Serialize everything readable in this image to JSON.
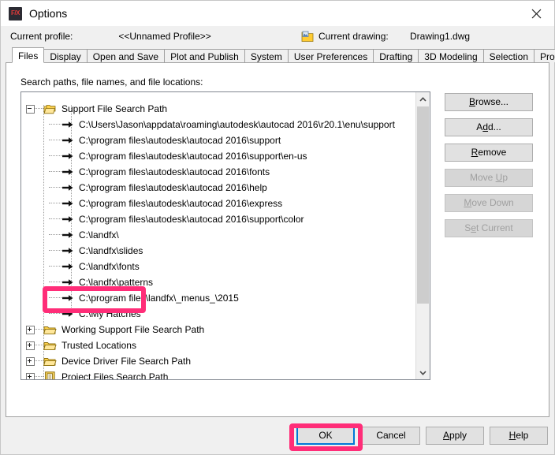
{
  "window": {
    "title": "Options",
    "app_icon": "fx-logo-icon",
    "close_icon": "close-icon"
  },
  "profile_bar": {
    "profile_label": "Current profile:",
    "profile_value": "<<Unnamed Profile>>",
    "drawing_icon": "drawing-file-icon",
    "drawing_label": "Current drawing:",
    "drawing_value": "Drawing1.dwg"
  },
  "tabs": [
    {
      "label": "Files",
      "active": true
    },
    {
      "label": "Display",
      "active": false
    },
    {
      "label": "Open and Save",
      "active": false
    },
    {
      "label": "Plot and Publish",
      "active": false
    },
    {
      "label": "System",
      "active": false
    },
    {
      "label": "User Preferences",
      "active": false
    },
    {
      "label": "Drafting",
      "active": false
    },
    {
      "label": "3D Modeling",
      "active": false
    },
    {
      "label": "Selection",
      "active": false
    },
    {
      "label": "Profiles",
      "active": false
    }
  ],
  "files_panel": {
    "section_label": "Search paths, file names, and file locations:",
    "tree": [
      {
        "type": "group",
        "state": "expanded",
        "icon": "folders-icon",
        "label": "Support File Search Path"
      },
      {
        "type": "path",
        "icon": "arrow-icon",
        "label": "C:\\Users\\Jason\\appdata\\roaming\\autodesk\\autocad 2016\\r20.1\\enu\\support"
      },
      {
        "type": "path",
        "icon": "arrow-icon",
        "label": "C:\\program files\\autodesk\\autocad 2016\\support"
      },
      {
        "type": "path",
        "icon": "arrow-icon",
        "label": "C:\\program files\\autodesk\\autocad 2016\\support\\en-us"
      },
      {
        "type": "path",
        "icon": "arrow-icon",
        "label": "C:\\program files\\autodesk\\autocad 2016\\fonts"
      },
      {
        "type": "path",
        "icon": "arrow-icon",
        "label": "C:\\program files\\autodesk\\autocad 2016\\help"
      },
      {
        "type": "path",
        "icon": "arrow-icon",
        "label": "C:\\program files\\autodesk\\autocad 2016\\express"
      },
      {
        "type": "path",
        "icon": "arrow-icon",
        "label": "C:\\program files\\autodesk\\autocad 2016\\support\\color"
      },
      {
        "type": "path",
        "icon": "arrow-icon",
        "label": "C:\\landfx\\"
      },
      {
        "type": "path",
        "icon": "arrow-icon",
        "label": "C:\\landfx\\slides"
      },
      {
        "type": "path",
        "icon": "arrow-icon",
        "label": "C:\\landfx\\fonts"
      },
      {
        "type": "path",
        "icon": "arrow-icon",
        "label": "C:\\landfx\\patterns"
      },
      {
        "type": "path",
        "icon": "arrow-icon",
        "label": "C:\\program files\\landfx\\_menus_\\2015"
      },
      {
        "type": "path",
        "icon": "arrow-icon",
        "label": "C:\\My Hatches",
        "highlighted": true
      },
      {
        "type": "group",
        "state": "collapsed",
        "icon": "folders-icon",
        "label": "Working Support File Search Path"
      },
      {
        "type": "group",
        "state": "collapsed",
        "icon": "folders-icon",
        "label": "Trusted Locations"
      },
      {
        "type": "group",
        "state": "collapsed",
        "icon": "folders-icon",
        "label": "Device Driver File Search Path"
      },
      {
        "type": "group",
        "state": "collapsed",
        "icon": "document-icon",
        "label": "Project Files Search Path"
      }
    ],
    "side_buttons": [
      {
        "label": "Browse...",
        "mnemonic": "B",
        "enabled": true
      },
      {
        "label": "Add...",
        "mnemonic": "d",
        "enabled": true
      },
      {
        "label": "Remove",
        "mnemonic": "R",
        "enabled": true
      },
      {
        "label": "Move Up",
        "mnemonic": "U",
        "enabled": false
      },
      {
        "label": "Move Down",
        "mnemonic": "M",
        "enabled": false
      },
      {
        "label": "Set Current",
        "mnemonic": "e",
        "enabled": false
      }
    ],
    "scrollbar": {
      "up_icon": "chevron-up-icon",
      "down_icon": "chevron-down-icon"
    }
  },
  "footer_buttons": [
    {
      "label": "OK",
      "mnemonic": "",
      "focused": true
    },
    {
      "label": "Cancel",
      "mnemonic": "",
      "focused": false
    },
    {
      "label": "Apply",
      "mnemonic": "A",
      "focused": false
    },
    {
      "label": "Help",
      "mnemonic": "H",
      "focused": false
    }
  ],
  "annotations": {
    "color": "#ff2d78",
    "targets": [
      "C:\\My Hatches",
      "OK"
    ]
  }
}
